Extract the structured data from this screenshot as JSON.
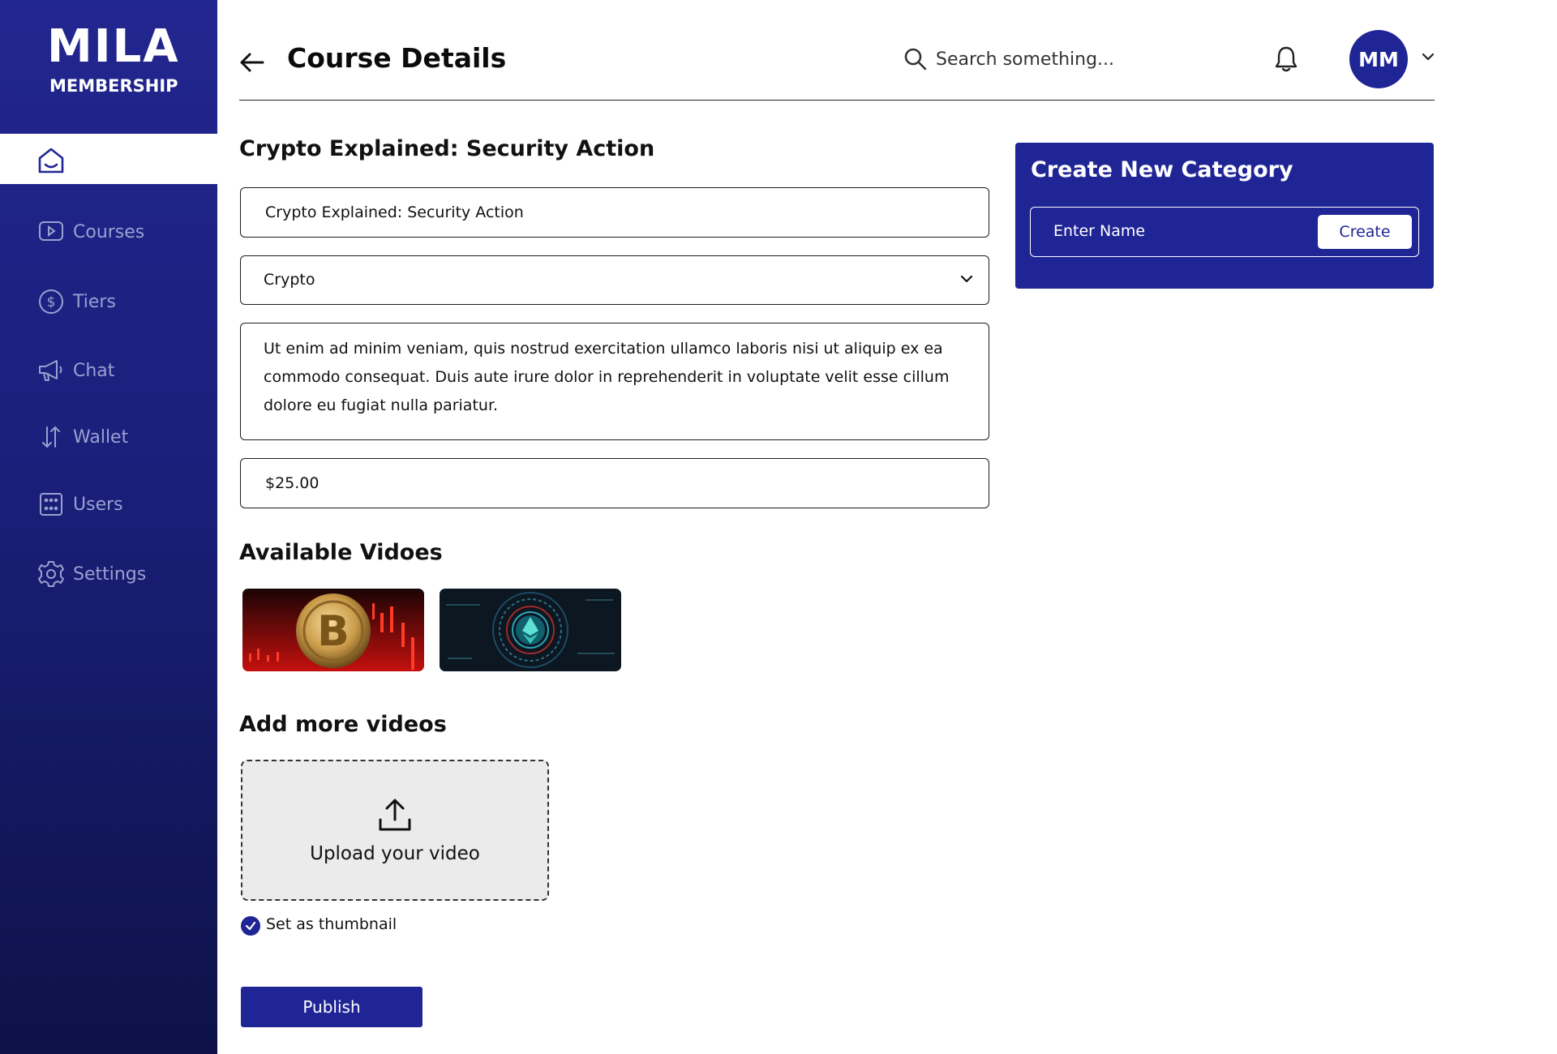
{
  "brand": {
    "logo_top": "MILA",
    "logo_bottom": "MEMBERSHIP"
  },
  "sidebar": {
    "items": [
      {
        "label": "Courses",
        "icon": "play-icon"
      },
      {
        "label": "Tiers",
        "icon": "dollar-circle-icon"
      },
      {
        "label": "Chat",
        "icon": "megaphone-icon"
      },
      {
        "label": "Wallet",
        "icon": "transfer-arrows-icon"
      },
      {
        "label": "Users",
        "icon": "users-grid-icon"
      },
      {
        "label": "Settings",
        "icon": "gear-icon"
      }
    ],
    "active": "home"
  },
  "header": {
    "title": "Course Details",
    "search_placeholder": "Search something...",
    "avatar_initials": "MM"
  },
  "course": {
    "heading": "Crypto Explained: Security Action",
    "title_value": "Crypto Explained: Security Action",
    "category_value": "Crypto",
    "description": "Ut enim ad minim veniam, quis nostrud exercitation ullamco laboris nisi ut aliquip ex ea commodo consequat. Duis aute irure dolor in reprehenderit in voluptate velit esse cillum dolore eu fugiat nulla pariatur.",
    "price_value": "$25.00"
  },
  "videos": {
    "available_title": "Available Vidoes",
    "items": [
      {
        "name": "bitcoin-thumbnail"
      },
      {
        "name": "ethereum-thumbnail"
      }
    ],
    "add_title": "Add more videos",
    "upload_label": "Upload your video",
    "thumbnail_label": "Set as thumbnail"
  },
  "category_panel": {
    "title": "Create New Category",
    "input_placeholder": "Enter Name",
    "create_label": "Create"
  },
  "actions": {
    "publish_label": "Publish"
  },
  "colors": {
    "brand": "#202596",
    "sidebar_top": "#22268f",
    "sidebar_bottom": "#0e1248"
  }
}
